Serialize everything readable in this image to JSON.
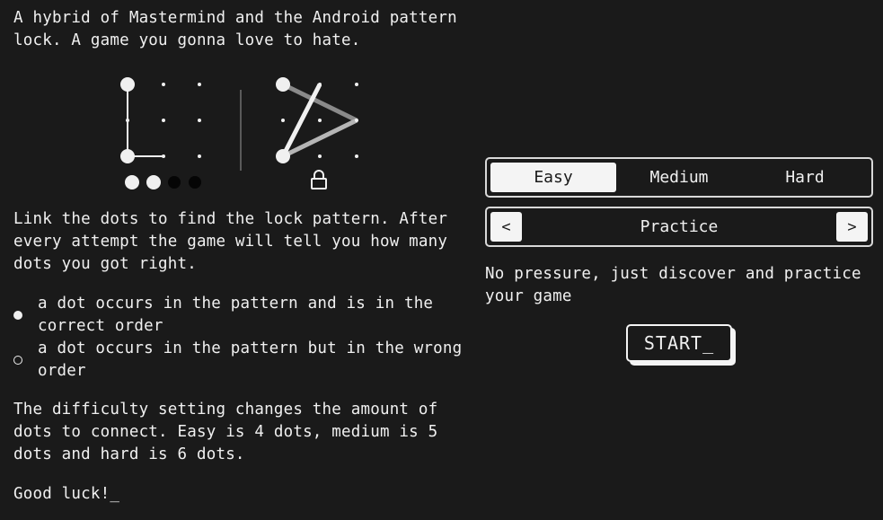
{
  "instructions": {
    "intro": "A hybrid of Mastermind and the Android pattern lock. A game you gonna love to hate.",
    "rules": "Link the dots to find the lock pattern. After every attempt the game will tell you how many dots you got right.",
    "legend": [
      {
        "marker": "filled-dot",
        "text": "a dot occurs in the pattern and is in the correct order"
      },
      {
        "marker": "empty-dot",
        "text": "a dot occurs in the pattern but in the wrong order"
      }
    ],
    "difficulty_info": "The difficulty setting changes the amount of dots to connect. Easy is 4 dots, medium is 5 dots and hard is 6 dots.",
    "sign_off": "Good luck!_"
  },
  "illustration": {
    "left_pattern_feedback": {
      "correct": 2,
      "wrong_order": 2
    },
    "right_icon": "lock-icon"
  },
  "settings": {
    "difficulty": {
      "options": [
        "Easy",
        "Medium",
        "Hard"
      ],
      "selected": "Easy"
    },
    "mode": {
      "prev_label": "<",
      "current": "Practice",
      "next_label": ">",
      "description": "No pressure, just discover and practice your game"
    },
    "start_label": "START_"
  },
  "colors": {
    "background": "#1a1a1a",
    "foreground": "#f0f0f0",
    "button_fill": "#f4f4f4",
    "pattern_line_gray": "#8a8a8a"
  }
}
